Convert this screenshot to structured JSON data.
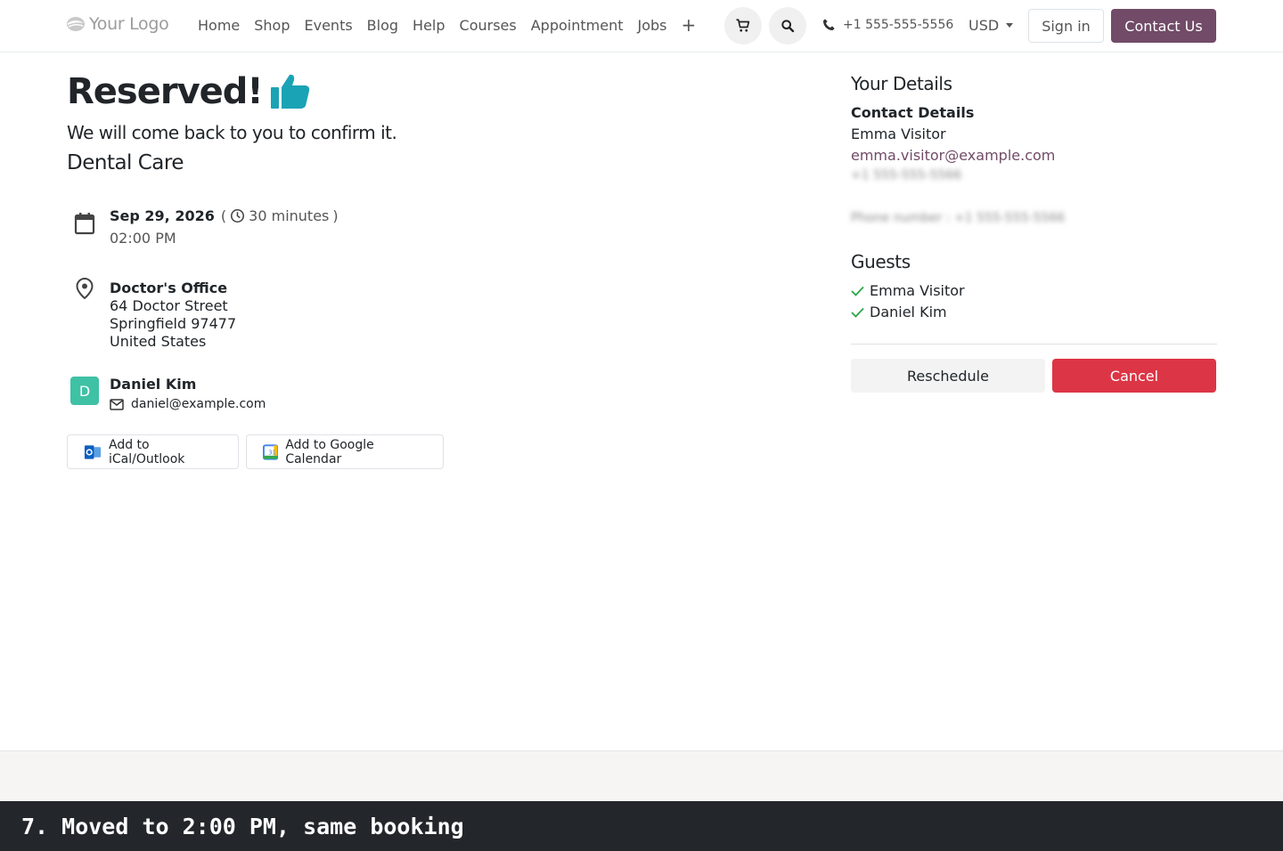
{
  "header": {
    "logo_text": "Your Logo",
    "nav": [
      "Home",
      "Shop",
      "Events",
      "Blog",
      "Help",
      "Courses",
      "Appointment",
      "Jobs"
    ],
    "plus": "+",
    "phone": "+1 555-555-5556",
    "currency": "USD",
    "signin": "Sign in",
    "contact": "Contact Us"
  },
  "confirmation": {
    "title": "Reserved!",
    "subtitle": "We will come back to you to confirm it.",
    "service": "Dental Care",
    "date": "Sep 29, 2026",
    "duration": "30 minutes",
    "time": "02:00 PM",
    "location": {
      "name": "Doctor's Office",
      "street": "64 Doctor Street",
      "city": "Springfield 97477",
      "country": "United States"
    },
    "staff": {
      "initial": "D",
      "name": "Daniel Kim",
      "email": "daniel@example.com"
    },
    "ical_label": "Add to iCal/Outlook",
    "google_label": "Add to Google Calendar"
  },
  "details": {
    "title": "Your Details",
    "contact_heading": "Contact Details",
    "name": "Emma Visitor",
    "email": "emma.visitor@example.com",
    "phone_blurred": "+1 555-555-5566",
    "phone_field_blurred": "Phone number : +1 555-555-5566",
    "guests_heading": "Guests",
    "guests": [
      "Emma Visitor",
      "Daniel Kim"
    ],
    "reschedule": "Reschedule",
    "cancel": "Cancel"
  },
  "caption": "7. Moved to 2:00 PM, same booking",
  "colors": {
    "brand": "#714b67",
    "danger": "#dc3545",
    "avatar": "#3fc1a5",
    "thumb": "#1aa3b5"
  }
}
